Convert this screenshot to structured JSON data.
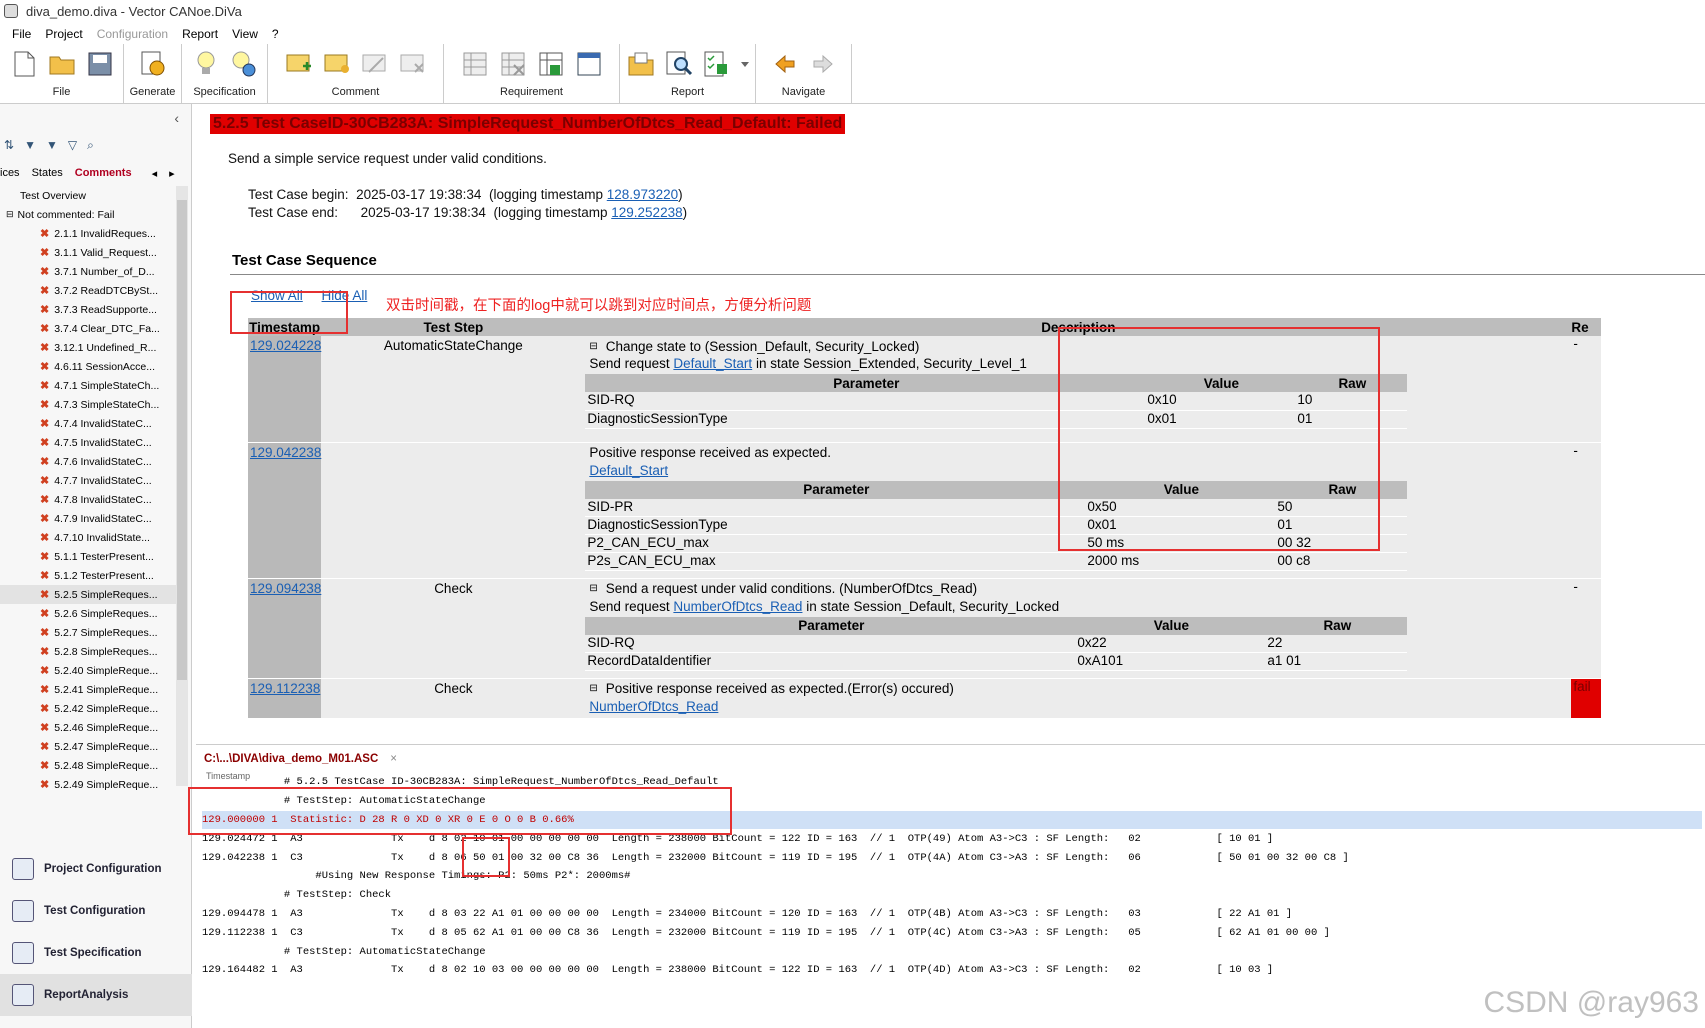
{
  "window": {
    "title": "diva_demo.diva - Vector CANoe.DiVa"
  },
  "menu": [
    "File",
    "Project",
    "Configuration",
    "Report",
    "View",
    "?"
  ],
  "ribbon": {
    "groups": [
      "File",
      "Generate",
      "Specification",
      "Comment",
      "Requirement",
      "Report",
      "Navigate"
    ]
  },
  "left": {
    "tabs": [
      "ices",
      "States",
      "Comments"
    ],
    "tree": {
      "root": "Test Overview",
      "group": "Not commented: Fail",
      "items": [
        "2.1.1 InvalidReques...",
        "3.1.1 Valid_Request...",
        "3.7.1 Number_of_D...",
        "3.7.2 ReadDTCBySt...",
        "3.7.3 ReadSupporte...",
        "3.7.4 Clear_DTC_Fa...",
        "3.12.1 Undefined_R...",
        "4.6.11 SessionAcce...",
        "4.7.1 SimpleStateCh...",
        "4.7.3 SimpleStateCh...",
        "4.7.4 InvalidStateC...",
        "4.7.5 InvalidStateC...",
        "4.7.6 InvalidStateC...",
        "4.7.7 InvalidStateC...",
        "4.7.8 InvalidStateC...",
        "4.7.9 InvalidStateC...",
        "4.7.10 InvalidState...",
        "5.1.1 TesterPresent...",
        "5.1.2 TesterPresent...",
        "5.2.5 SimpleReques...",
        "5.2.6 SimpleReques...",
        "5.2.7 SimpleReques...",
        "5.2.8 SimpleReques...",
        "5.2.40 SimpleReque...",
        "5.2.41 SimpleReque...",
        "5.2.42 SimpleReque...",
        "5.2.46 SimpleReque...",
        "5.2.47 SimpleReque...",
        "5.2.48 SimpleReque...",
        "5.2.49 SimpleReque..."
      ]
    },
    "nav": [
      "Project Configuration",
      "Test Configuration",
      "Test Specification",
      "ReportAnalysis"
    ]
  },
  "report": {
    "heading": "5.2.5 Test CaseID-30CB283A: SimpleRequest_NumberOfDtcs_Read_Default: Failed",
    "desc": "Send a simple service request under valid conditions.",
    "begin": {
      "label": "Test Case begin:",
      "time": "2025-03-17 19:38:34",
      "pre": "(logging timestamp ",
      "ts": "128.973220",
      "post": ")"
    },
    "end": {
      "label": "Test Case end:",
      "time": "2025-03-17 19:38:34",
      "pre": "(logging timestamp ",
      "ts": "129.252238",
      "post": ")"
    },
    "seq_title": "Test Case Sequence",
    "show_all": "Show All",
    "hide_all": "Hide All",
    "annotation": "双击时间戳，在下面的log中就可以跳到对应时间点，方便分析问题",
    "cols": [
      "Timestamp",
      "Test Step",
      "Description",
      "Re"
    ],
    "rows": [
      {
        "ts": "129.024228",
        "step": "AutomaticStateChange",
        "title": "Change state to (Session_Default, Security_Locked)",
        "sub_pre": "Send request ",
        "sub_link": "Default_Start",
        "sub_post": " in state Session_Extended, Security_Level_1",
        "params": [
          [
            "Parameter",
            "Value",
            "Raw"
          ],
          [
            "SID-RQ",
            "0x10",
            "10"
          ],
          [
            "DiagnosticSessionType",
            "0x01",
            "01"
          ]
        ],
        "res": "-"
      },
      {
        "ts": "129.042238",
        "step": "",
        "title": "Positive response received as expected.",
        "link": "Default_Start",
        "params": [
          [
            "Parameter",
            "Value",
            "Raw"
          ],
          [
            "SID-PR",
            "0x50",
            "50"
          ],
          [
            "DiagnosticSessionType",
            "0x01",
            "01"
          ],
          [
            "P2_CAN_ECU_max",
            "50 ms",
            "00 32"
          ],
          [
            "P2s_CAN_ECU_max",
            "2000 ms",
            "00 c8"
          ]
        ],
        "res": "-"
      },
      {
        "ts": "129.094238",
        "step": "Check",
        "title": "Send a request under valid conditions. (NumberOfDtcs_Read)",
        "sub_pre": "Send request ",
        "sub_link": "NumberOfDtcs_Read",
        "sub_post": " in state Session_Default, Security_Locked",
        "params": [
          [
            "Parameter",
            "Value",
            "Raw"
          ],
          [
            "SID-RQ",
            "0x22",
            "22"
          ],
          [
            "RecordDataIdentifier",
            "0xA101",
            "a1 01"
          ]
        ],
        "res": "-"
      },
      {
        "ts": "129.112238",
        "step": "Check",
        "title": "Positive response received as expected.(Error(s) occured)",
        "link": "NumberOfDtcs_Read",
        "res": "fail"
      }
    ]
  },
  "log": {
    "tab": "C:\\...\\DIVA\\diva_demo_M01.ASC",
    "close": "×",
    "header": "Timestamp",
    "lines": [
      "             # 5.2.5 TestCase ID-30CB283A: SimpleRequest_NumberOfDtcs_Read_Default",
      "             # TestStep: AutomaticStateChange",
      "129.000000 1  Statistic: D 28 R 0 XD 0 XR 0 E 0 O 0 B 0.66%",
      "129.024472 1  A3              Tx    d 8 02 10 01 00 00 00 00 00  Length = 238000 BitCount = 122 ID = 163  // 1  OTP(49) Atom A3->C3 : SF Length:   02            [ 10 01 ]",
      "129.042238 1  C3              Tx    d 8 06 50 01 00 32 00 C8 36  Length = 232000 BitCount = 119 ID = 195  // 1  OTP(4A) Atom C3->A3 : SF Length:   06            [ 50 01 00 32 00 C8 ]",
      "                  #Using New Response Timings: P2: 50ms P2*: 2000ms#",
      "             # TestStep: Check",
      "129.094478 1  A3              Tx    d 8 03 22 A1 01 00 00 00 00  Length = 234000 BitCount = 120 ID = 163  // 1  OTP(4B) Atom A3->C3 : SF Length:   03            [ 22 A1 01 ]",
      "129.112238 1  C3              Tx    d 8 05 62 A1 01 00 00 C8 36  Length = 232000 BitCount = 119 ID = 195  // 1  OTP(4C) Atom C3->A3 : SF Length:   05            [ 62 A1 01 00 00 ]",
      "             # TestStep: AutomaticStateChange",
      "129.164482 1  A3              Tx    d 8 02 10 03 00 00 00 00 00  Length = 238000 BitCount = 122 ID = 163  // 1  OTP(4D) Atom A3->C3 : SF Length:   02            [ 10 03 ]"
    ]
  },
  "watermark": "CSDN @ray963"
}
